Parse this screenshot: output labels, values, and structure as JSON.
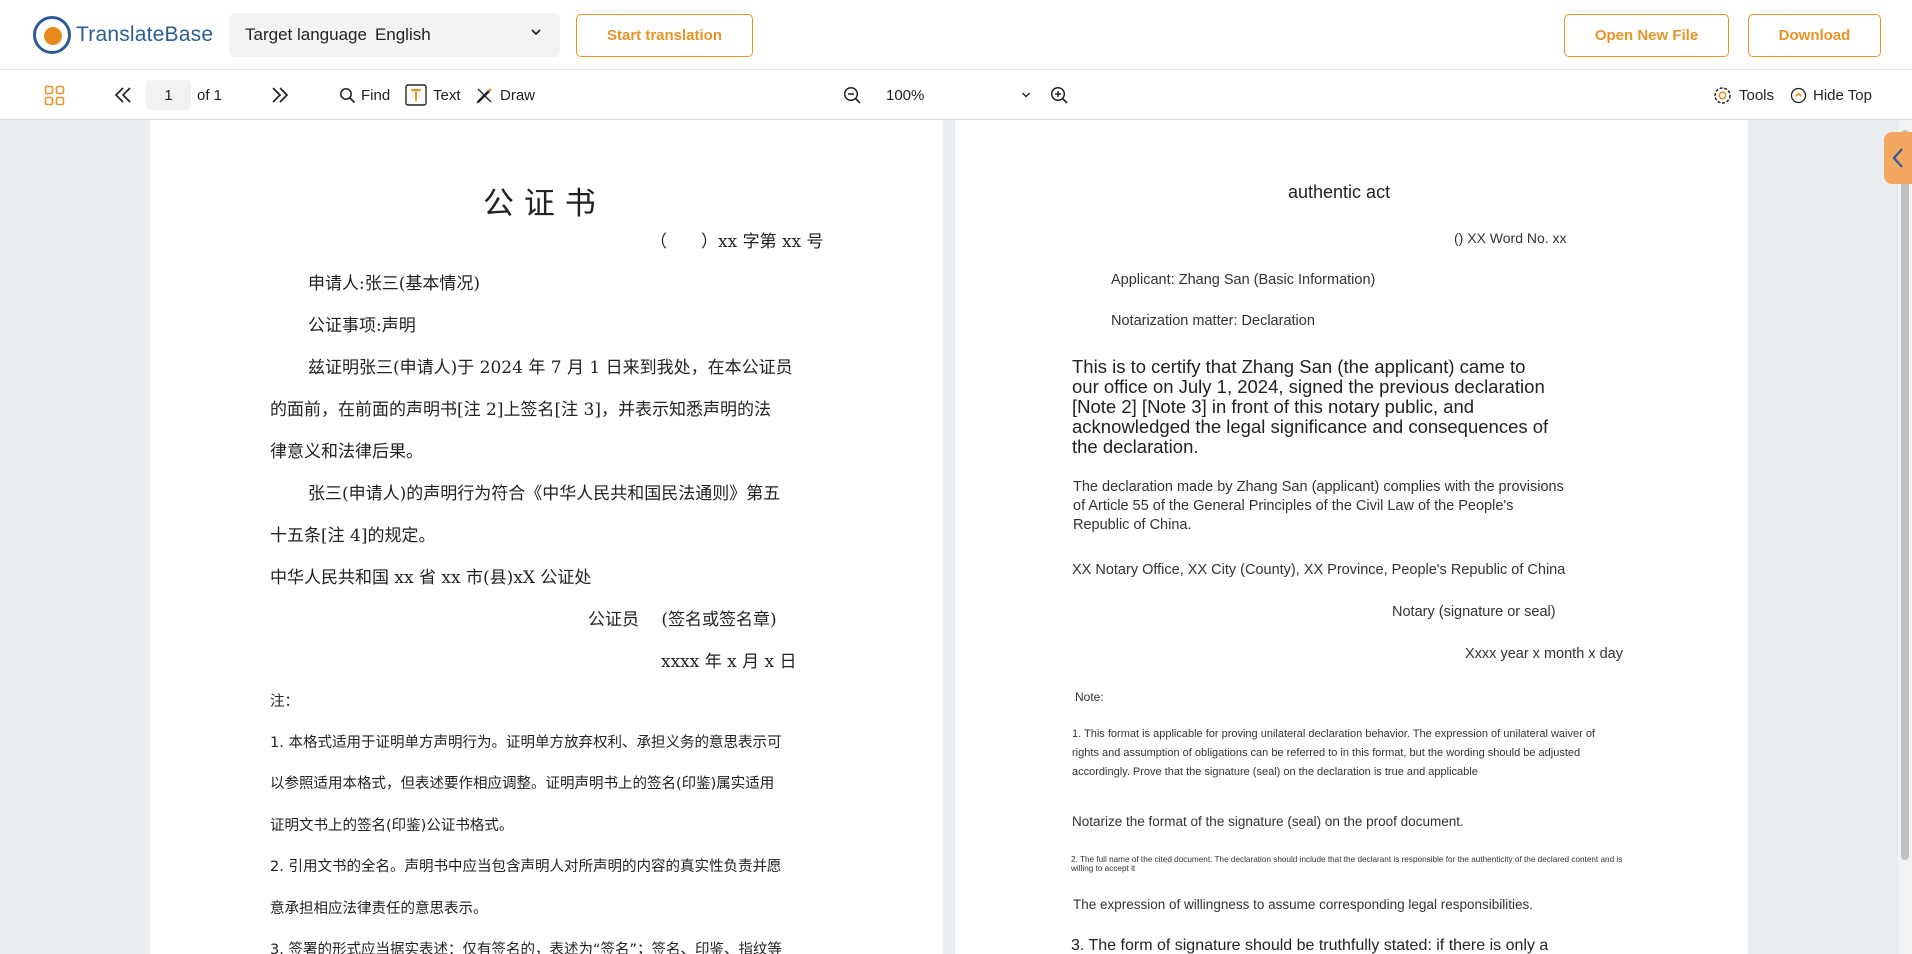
{
  "header": {
    "logo_text": "TranslateBase",
    "target_language_label": "Target language",
    "target_language_value": "English",
    "start_translation": "Start translation",
    "open_new_file": "Open New File",
    "download": "Download",
    "accent_color": "#e69425",
    "brand_color": "#2d5b9a"
  },
  "toolbar": {
    "page_current": "1",
    "page_total": "of 1",
    "find": "Find",
    "text": "Text",
    "draw": "Draw",
    "zoom": "100%",
    "tools": "Tools",
    "hide_top": "Hide Top"
  },
  "original": {
    "title": "公 证 书",
    "number": "（　　）xx 字第 xx 号",
    "applicant": "申请人:张三(基本情况)",
    "matter": "公证事项:声明",
    "body1_l1": "兹证明张三(申请人)于 2024 年 7 月 1 日来到我处，在本公证员",
    "body1_l2": "的面前，在前面的声明书[注 2]上签名[注 3]，并表示知悉声明的法",
    "body1_l3": "律意义和法律后果。",
    "body2_l1": "张三(申请人)的声明行为符合《中华人民共和国民法通则》第五",
    "body2_l2": "十五条[注 4]的规定。",
    "office": "中华人民共和国 xx 省 xx 市(县)xX 公证处",
    "notary": "公证员　 (签名或签名章)",
    "date": "xxxx 年 x 月 x 日",
    "note_title": "注：",
    "note1_l1": "1. 本格式适用于证明单方声明行为。证明单方放弃权利、承担义务的意思表示可",
    "note1_l2": "以参照适用本格式，但表述要作相应调整。证明声明书上的签名(印鉴)属实适用",
    "note1_l3": "证明文书上的签名(印鉴)公证书格式。",
    "note2_l1": "2. 引用文书的全名。声明书中应当包含声明人对所声明的内容的真实性负责并愿",
    "note2_l2": "意承担相应法律责任的意思表示。",
    "note3_l1": "3. 签署的形式应当据实表述：仅有签名的，表述为“签名”；签名、印鉴、指纹等"
  },
  "translation": {
    "title": "authentic act",
    "number": "() XX Word No. xx",
    "applicant": "Applicant: Zhang San (Basic Information)",
    "matter": "Notarization matter: Declaration",
    "body1_l1": "This is to certify that Zhang San (the applicant) came to",
    "body1_l2": "our office on July 1, 2024, signed the previous declaration",
    "body1_l3": "[Note 2] [Note 3] in front of this notary public, and",
    "body1_l4": "acknowledged the legal significance and consequences of",
    "body1_l5": "the declaration.",
    "body2_l1": "The declaration made by Zhang San (applicant) complies with the provisions",
    "body2_l2": "of Article 55 of the General Principles of the Civil Law of the People's",
    "body2_l3": "Republic of China.",
    "office": "XX Notary Office, XX City (County), XX Province, People's Republic of China",
    "notary": "Notary (signature or seal)",
    "date": "Xxxx year x month x day",
    "note_title": "Note:",
    "note1_l1": "1. This format is applicable for proving unilateral declaration behavior. The expression of unilateral waiver of",
    "note1_l2": "rights and assumption of obligations can be referred to in this format, but the wording should be adjusted",
    "note1_l3": "accordingly. Prove that the signature (seal) on the declaration is true and applicable",
    "note1b": "Notarize the format of the signature (seal) on the proof document.",
    "note2_l1": "2. The full name of the cited document. The declaration should include that the declarant is responsible for the authenticity of the declared content and is",
    "note2_l2": "willing to accept it",
    "note2b": "The expression of willingness to assume corresponding legal responsibilities.",
    "note3_l1": "3. The form of signature should be truthfully stated: if there is only a"
  }
}
